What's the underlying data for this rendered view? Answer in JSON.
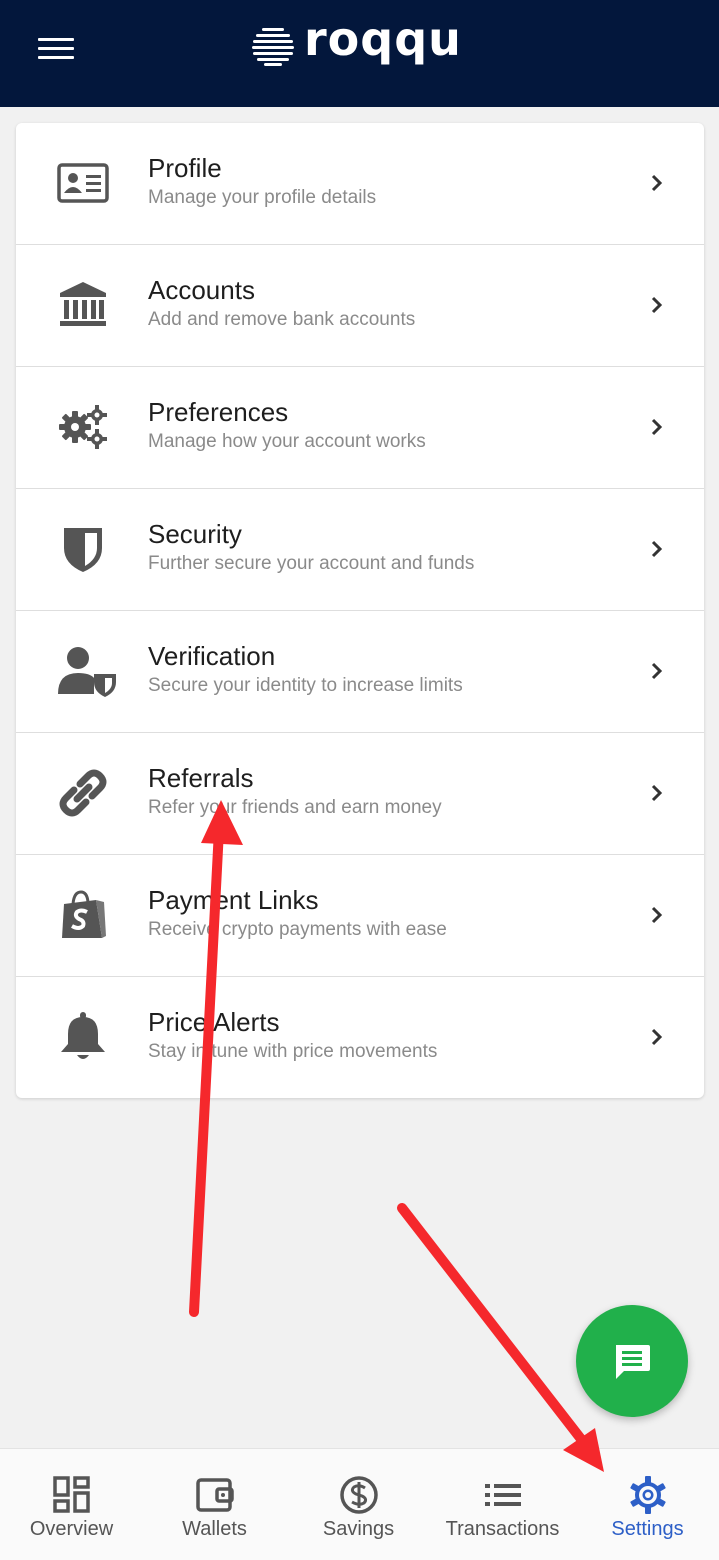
{
  "header": {
    "brand": "roqqu",
    "menu_icon": "hamburger-menu-icon",
    "background": "#03173c"
  },
  "settings_menu": [
    {
      "title": "Profile",
      "subtitle": "Manage your profile details",
      "icon": "id-card-icon"
    },
    {
      "title": "Accounts",
      "subtitle": "Add and remove bank accounts",
      "icon": "bank-icon"
    },
    {
      "title": "Preferences",
      "subtitle": "Manage how your account works",
      "icon": "gears-icon"
    },
    {
      "title": "Security",
      "subtitle": "Further secure your account and funds",
      "icon": "shield-icon"
    },
    {
      "title": "Verification",
      "subtitle": "Secure your identity to increase limits",
      "icon": "user-shield-icon"
    },
    {
      "title": "Referrals",
      "subtitle": "Refer your friends and earn money",
      "icon": "link-icon"
    },
    {
      "title": "Payment Links",
      "subtitle": "Receive crypto payments with ease",
      "icon": "shopping-bag-icon"
    },
    {
      "title": "Price Alerts",
      "subtitle": "Stay in tune with price movements",
      "icon": "bell-icon"
    }
  ],
  "chat_button": {
    "icon": "chat-icon",
    "color": "#21b04b"
  },
  "bottom_nav": [
    {
      "label": "Overview",
      "icon": "dashboard-icon"
    },
    {
      "label": "Wallets",
      "icon": "wallet-icon"
    },
    {
      "label": "Savings",
      "icon": "dollar-circle-icon"
    },
    {
      "label": "Transactions",
      "icon": "list-icon"
    },
    {
      "label": "Settings",
      "icon": "gear-icon",
      "active": true
    }
  ],
  "colors": {
    "active_tab": "#2d5fc7",
    "annotation_arrow": "#f5282c",
    "icon_gray": "#555555"
  }
}
